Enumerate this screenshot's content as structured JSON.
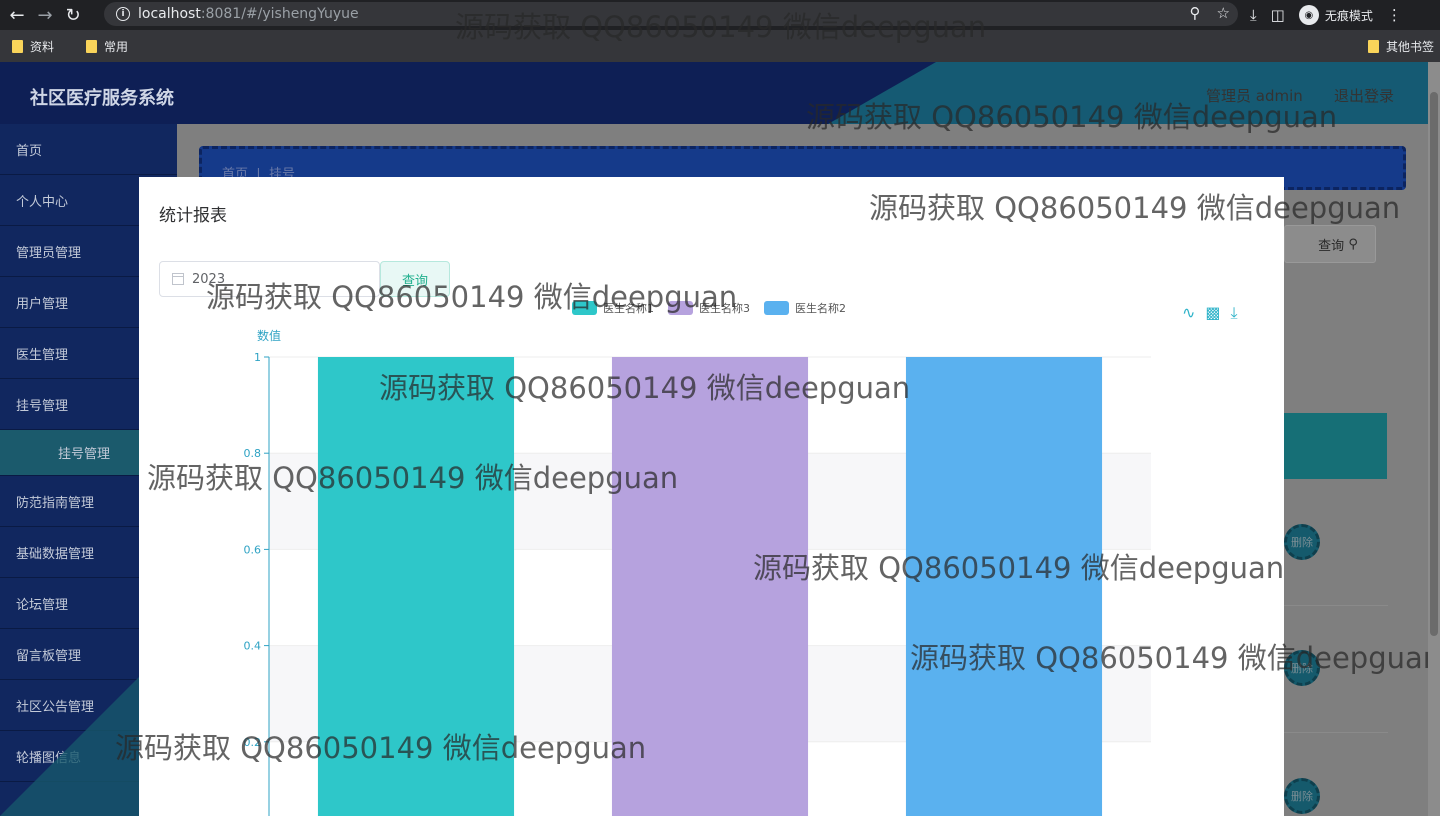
{
  "browser": {
    "url_host": "localhost",
    "url_rest": ":8081/#/yishengYuyue",
    "incognito_label": "无痕模式",
    "bookmarks": [
      "资料",
      "常用"
    ],
    "other_bookmarks": "其他书签"
  },
  "app": {
    "title": "社区医疗服务系统",
    "user": "管理员 admin",
    "logout": "退出登录"
  },
  "sidebar": {
    "items": [
      {
        "label": "首页"
      },
      {
        "label": "个人中心"
      },
      {
        "label": "管理员管理"
      },
      {
        "label": "用户管理"
      },
      {
        "label": "医生管理"
      },
      {
        "label": "挂号管理"
      }
    ],
    "sub_item": "挂号管理",
    "items_after": [
      {
        "label": "防范指南管理"
      },
      {
        "label": "基础数据管理"
      },
      {
        "label": "论坛管理"
      },
      {
        "label": "留言板管理"
      },
      {
        "label": "社区公告管理"
      },
      {
        "label": "轮播图信息"
      }
    ]
  },
  "breadcrumb": {
    "home": "首页",
    "sep": "|",
    "current": "挂号"
  },
  "background": {
    "search_button": "查询",
    "delete_label": "删除"
  },
  "modal": {
    "title": "统计报表",
    "date_value": "2023",
    "query_button": "查询"
  },
  "watermark": "源码获取 QQ86050149 微信deepguan",
  "colors": {
    "series1": "#2ec7c9",
    "series2": "#b6a2de",
    "series3": "#5ab1ef",
    "axis": "#2fa3c4"
  },
  "chart_data": {
    "type": "bar",
    "ylabel": "数值",
    "yticks": [
      0.2,
      0.4,
      0.6,
      0.8,
      1
    ],
    "ylim": [
      0,
      1
    ],
    "legend_position": "top-center",
    "series": [
      {
        "name": "医生名称1",
        "values": [
          1
        ]
      },
      {
        "name": "医生名称3",
        "values": [
          1
        ]
      },
      {
        "name": "医生名称2",
        "values": [
          1
        ]
      }
    ]
  }
}
